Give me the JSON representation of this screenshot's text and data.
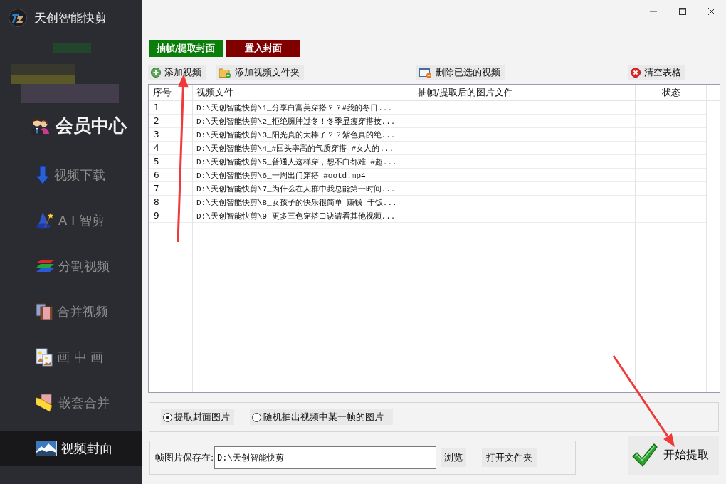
{
  "window": {
    "title": "天创智能快剪"
  },
  "sidebar": {
    "member_center": "会员中心",
    "items": [
      {
        "label": "视频下载",
        "selected": false
      },
      {
        "label": "A I 智剪",
        "selected": false
      },
      {
        "label": "分割视频",
        "selected": false
      },
      {
        "label": "合并视频",
        "selected": false
      },
      {
        "label": "画 中 画",
        "selected": false
      },
      {
        "label": "嵌套合并",
        "selected": false
      },
      {
        "label": "视频封面",
        "selected": true
      }
    ]
  },
  "tabs": [
    {
      "label": "抽帧/提取封面",
      "color": "#0a7d0a"
    },
    {
      "label": "置入封面",
      "color": "#800000"
    }
  ],
  "toolbar": [
    {
      "label": "添加视频"
    },
    {
      "label": "添加视频文件夹"
    },
    {
      "label": "删除已选的视频"
    },
    {
      "label": "清空表格"
    }
  ],
  "table": {
    "columns": [
      "序号",
      "视频文件",
      "抽帧/提取后的图片文件",
      "状态"
    ],
    "rows": [
      {
        "number": "1",
        "video_file": "D:\\天创智能快剪\\1_分享白富美穿搭？？#我的冬日..."
      },
      {
        "number": "2",
        "video_file": "D:\\天创智能快剪\\2_拒绝臃肿过冬！冬季显瘦穿搭技..."
      },
      {
        "number": "3",
        "video_file": "D:\\天创智能快剪\\3_阳光真的太棒了？？紫色真的绝..."
      },
      {
        "number": "4",
        "video_file": "D:\\天创智能快剪\\4_#回头率高的气质穿搭 #女人的..."
      },
      {
        "number": "5",
        "video_file": "D:\\天创智能快剪\\5_普通人这样穿，想不白都难 #超..."
      },
      {
        "number": "6",
        "video_file": "D:\\天创智能快剪\\6_一周出门穿搭 #ootd.mp4"
      },
      {
        "number": "7",
        "video_file": "D:\\天创智能快剪\\7_为什么在人群中我总能第一时间..."
      },
      {
        "number": "8",
        "video_file": "D:\\天创智能快剪\\8_女孩子的快乐很简单 赚钱 干饭..."
      },
      {
        "number": "9",
        "video_file": "D:\\天创智能快剪\\9_更多三色穿搭口诀请看其他视频..."
      }
    ]
  },
  "extract_mode": {
    "options": [
      {
        "label": "提取封面图片",
        "selected": true
      },
      {
        "label": "随机抽出视频中某一帧的图片",
        "selected": false
      }
    ]
  },
  "save_location": {
    "label": "帧图片保存在:",
    "value": "D:\\天创智能快剪",
    "browse_button": "浏览",
    "open_folder_button": "打开文件夹"
  },
  "start_button": "开始提取"
}
